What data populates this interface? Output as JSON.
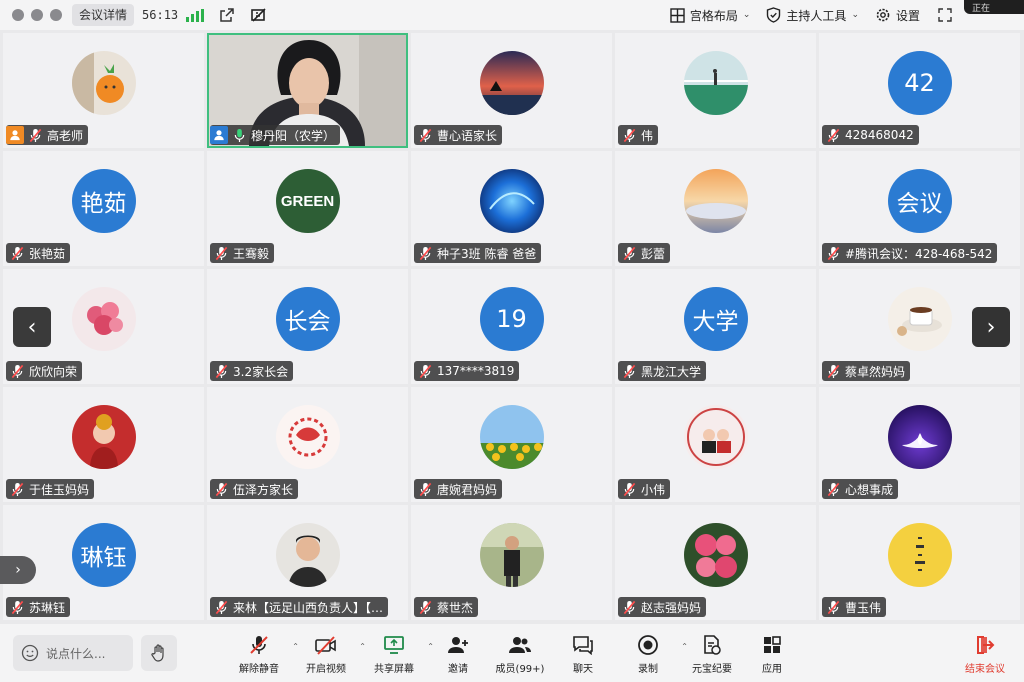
{
  "titlebar": {
    "meeting_info": "会议详情",
    "timer": "56:13",
    "layout_label": "宫格布局",
    "host_tools_label": "主持人工具",
    "settings_label": "设置",
    "corner_overlay": "正在"
  },
  "participants": [
    {
      "name": "高老师",
      "avatar": "photo-carrot",
      "role": "host"
    },
    {
      "name": "穆丹阳（农学）",
      "avatar": "video",
      "role": "cohost"
    },
    {
      "name": "曹心语家长",
      "avatar": "photo-sunset"
    },
    {
      "name": "伟",
      "avatar": "photo-court"
    },
    {
      "name": "428468042",
      "avatar": "text",
      "text": "42"
    },
    {
      "name": "张艳茹",
      "avatar": "text",
      "text": "艳茹"
    },
    {
      "name": "王骞毅",
      "avatar": "green",
      "text": "GREEN"
    },
    {
      "name": "种子3班 陈睿  爸爸",
      "avatar": "photo-bluelight"
    },
    {
      "name": "彭蕾",
      "avatar": "photo-clouds"
    },
    {
      "name": "#腾讯会议：428-468-542",
      "avatar": "text",
      "text": "会议"
    },
    {
      "name": "欣欣向荣",
      "avatar": "photo-flowers"
    },
    {
      "name": "3.2家长会",
      "avatar": "text",
      "text": "长会"
    },
    {
      "name": "137****3819",
      "avatar": "text",
      "text": "19"
    },
    {
      "name": "黑龙江大学",
      "avatar": "text",
      "text": "大学"
    },
    {
      "name": "蔡卓然妈妈",
      "avatar": "photo-coffee"
    },
    {
      "name": "于佳玉妈妈",
      "avatar": "photo-redbaby"
    },
    {
      "name": "伍泽方家长",
      "avatar": "photo-papercut"
    },
    {
      "name": "唐婉君妈妈",
      "avatar": "photo-sunflower"
    },
    {
      "name": "小伟",
      "avatar": "photo-couple"
    },
    {
      "name": "心想事成",
      "avatar": "photo-lotus"
    },
    {
      "name": "苏琳钰",
      "avatar": "text",
      "text": "琳钰"
    },
    {
      "name": "来林【远足山西负责人】【…",
      "avatar": "photo-man1"
    },
    {
      "name": "蔡世杰",
      "avatar": "photo-man2"
    },
    {
      "name": "赵志强妈妈",
      "avatar": "photo-roses"
    },
    {
      "name": "曹玉伟",
      "avatar": "photo-yellow"
    }
  ],
  "toolbar": {
    "chat_placeholder": "说点什么...",
    "unmute": "解除静音",
    "start_video": "开启视频",
    "share_screen": "共享屏幕",
    "invite": "邀请",
    "members": "成员(99+)",
    "chat": "聊天",
    "record": "录制",
    "yuanbao": "元宝纪要",
    "apps": "应用",
    "end_meeting": "结束会议"
  }
}
